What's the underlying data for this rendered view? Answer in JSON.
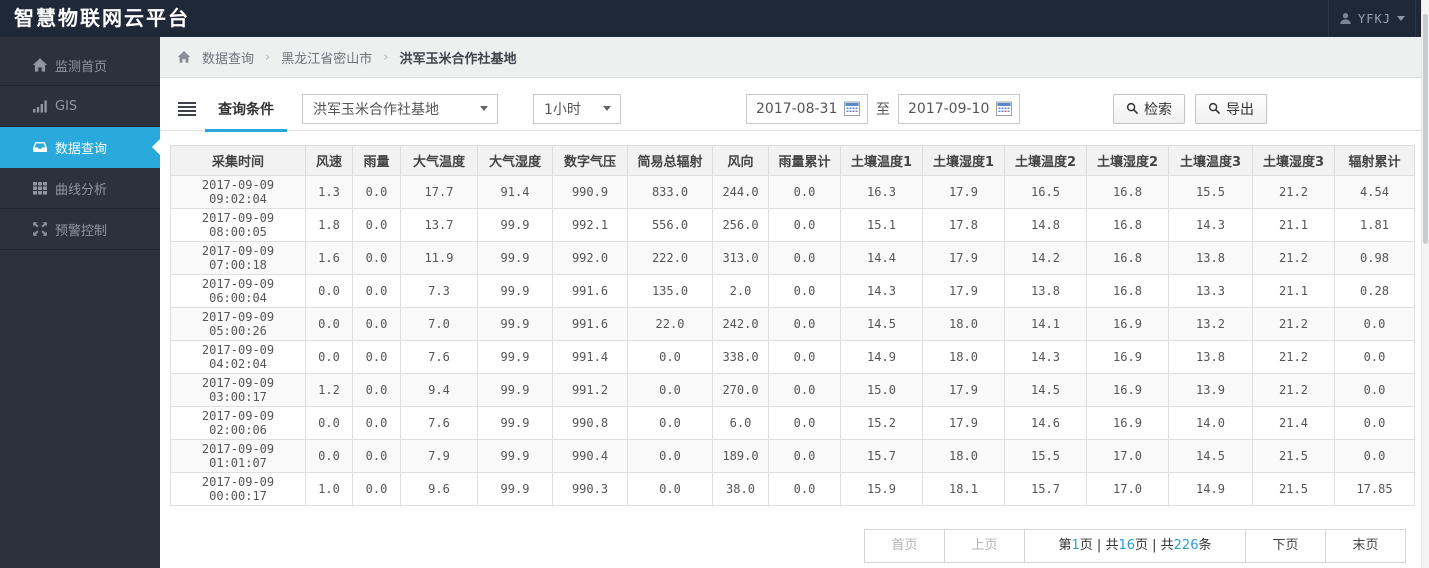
{
  "app": {
    "title": "智慧物联网云平台",
    "user": "YFKJ"
  },
  "colors": {
    "accent": "#29a9dc",
    "topbar_bg": "#1f2837",
    "sidebar_bg": "#2b323b",
    "highlight_number": "#2a9fd4"
  },
  "sidebar": {
    "items": [
      {
        "label": "监测首页",
        "icon": "home-icon",
        "active": false
      },
      {
        "label": "GIS",
        "icon": "bar-chart-icon",
        "active": false
      },
      {
        "label": "数据查询",
        "icon": "inbox-icon",
        "active": true
      },
      {
        "label": "曲线分析",
        "icon": "grid-icon",
        "active": false
      },
      {
        "label": "预警控制",
        "icon": "arrows-icon",
        "active": false
      }
    ]
  },
  "breadcrumb": {
    "separator": "›",
    "items": [
      "数据查询",
      "黑龙江省密山市",
      "洪军玉米合作社基地"
    ]
  },
  "query": {
    "tab_label": "查询条件",
    "station_select": "洪军玉米合作社基地",
    "interval_select": "1小时",
    "date_from": "2017-08-31",
    "to_label": "至",
    "date_to": "2017-09-10",
    "search_button": "检索",
    "export_button": "导出"
  },
  "table": {
    "columns": [
      "采集时间",
      "风速",
      "雨量",
      "大气温度",
      "大气湿度",
      "数字气压",
      "简易总辐射",
      "风向",
      "雨量累计",
      "土壤温度1",
      "土壤湿度1",
      "土壤温度2",
      "土壤湿度2",
      "土壤温度3",
      "土壤湿度3",
      "辐射累计"
    ],
    "rows": [
      [
        "2017-09-09 09:02:04",
        "1.3",
        "0.0",
        "17.7",
        "91.4",
        "990.9",
        "833.0",
        "244.0",
        "0.0",
        "16.3",
        "17.9",
        "16.5",
        "16.8",
        "15.5",
        "21.2",
        "4.54"
      ],
      [
        "2017-09-09 08:00:05",
        "1.8",
        "0.0",
        "13.7",
        "99.9",
        "992.1",
        "556.0",
        "256.0",
        "0.0",
        "15.1",
        "17.8",
        "14.8",
        "16.8",
        "14.3",
        "21.1",
        "1.81"
      ],
      [
        "2017-09-09 07:00:18",
        "1.6",
        "0.0",
        "11.9",
        "99.9",
        "992.0",
        "222.0",
        "313.0",
        "0.0",
        "14.4",
        "17.9",
        "14.2",
        "16.8",
        "13.8",
        "21.2",
        "0.98"
      ],
      [
        "2017-09-09 06:00:04",
        "0.0",
        "0.0",
        "7.3",
        "99.9",
        "991.6",
        "135.0",
        "2.0",
        "0.0",
        "14.3",
        "17.9",
        "13.8",
        "16.8",
        "13.3",
        "21.1",
        "0.28"
      ],
      [
        "2017-09-09 05:00:26",
        "0.0",
        "0.0",
        "7.0",
        "99.9",
        "991.6",
        "22.0",
        "242.0",
        "0.0",
        "14.5",
        "18.0",
        "14.1",
        "16.9",
        "13.2",
        "21.2",
        "0.0"
      ],
      [
        "2017-09-09 04:02:04",
        "0.0",
        "0.0",
        "7.6",
        "99.9",
        "991.4",
        "0.0",
        "338.0",
        "0.0",
        "14.9",
        "18.0",
        "14.3",
        "16.9",
        "13.8",
        "21.2",
        "0.0"
      ],
      [
        "2017-09-09 03:00:17",
        "1.2",
        "0.0",
        "9.4",
        "99.9",
        "991.2",
        "0.0",
        "270.0",
        "0.0",
        "15.0",
        "17.9",
        "14.5",
        "16.9",
        "13.9",
        "21.2",
        "0.0"
      ],
      [
        "2017-09-09 02:00:06",
        "0.0",
        "0.0",
        "7.6",
        "99.9",
        "990.8",
        "0.0",
        "6.0",
        "0.0",
        "15.2",
        "17.9",
        "14.6",
        "16.9",
        "14.0",
        "21.4",
        "0.0"
      ],
      [
        "2017-09-09 01:01:07",
        "0.0",
        "0.0",
        "7.9",
        "99.9",
        "990.4",
        "0.0",
        "189.0",
        "0.0",
        "15.7",
        "18.0",
        "15.5",
        "17.0",
        "14.5",
        "21.5",
        "0.0"
      ],
      [
        "2017-09-09 00:00:17",
        "1.0",
        "0.0",
        "9.6",
        "99.9",
        "990.3",
        "0.0",
        "38.0",
        "0.0",
        "15.9",
        "18.1",
        "15.7",
        "17.0",
        "14.9",
        "21.5",
        "17.85"
      ]
    ]
  },
  "pagination": {
    "first": "首页",
    "prev": "上页",
    "info": {
      "prefix": "第",
      "page": "1",
      "mid1": "页 | 共",
      "pages": "16",
      "mid2": "页 | 共",
      "total": "226",
      "suffix": "条"
    },
    "next": "下页",
    "last": "末页"
  }
}
